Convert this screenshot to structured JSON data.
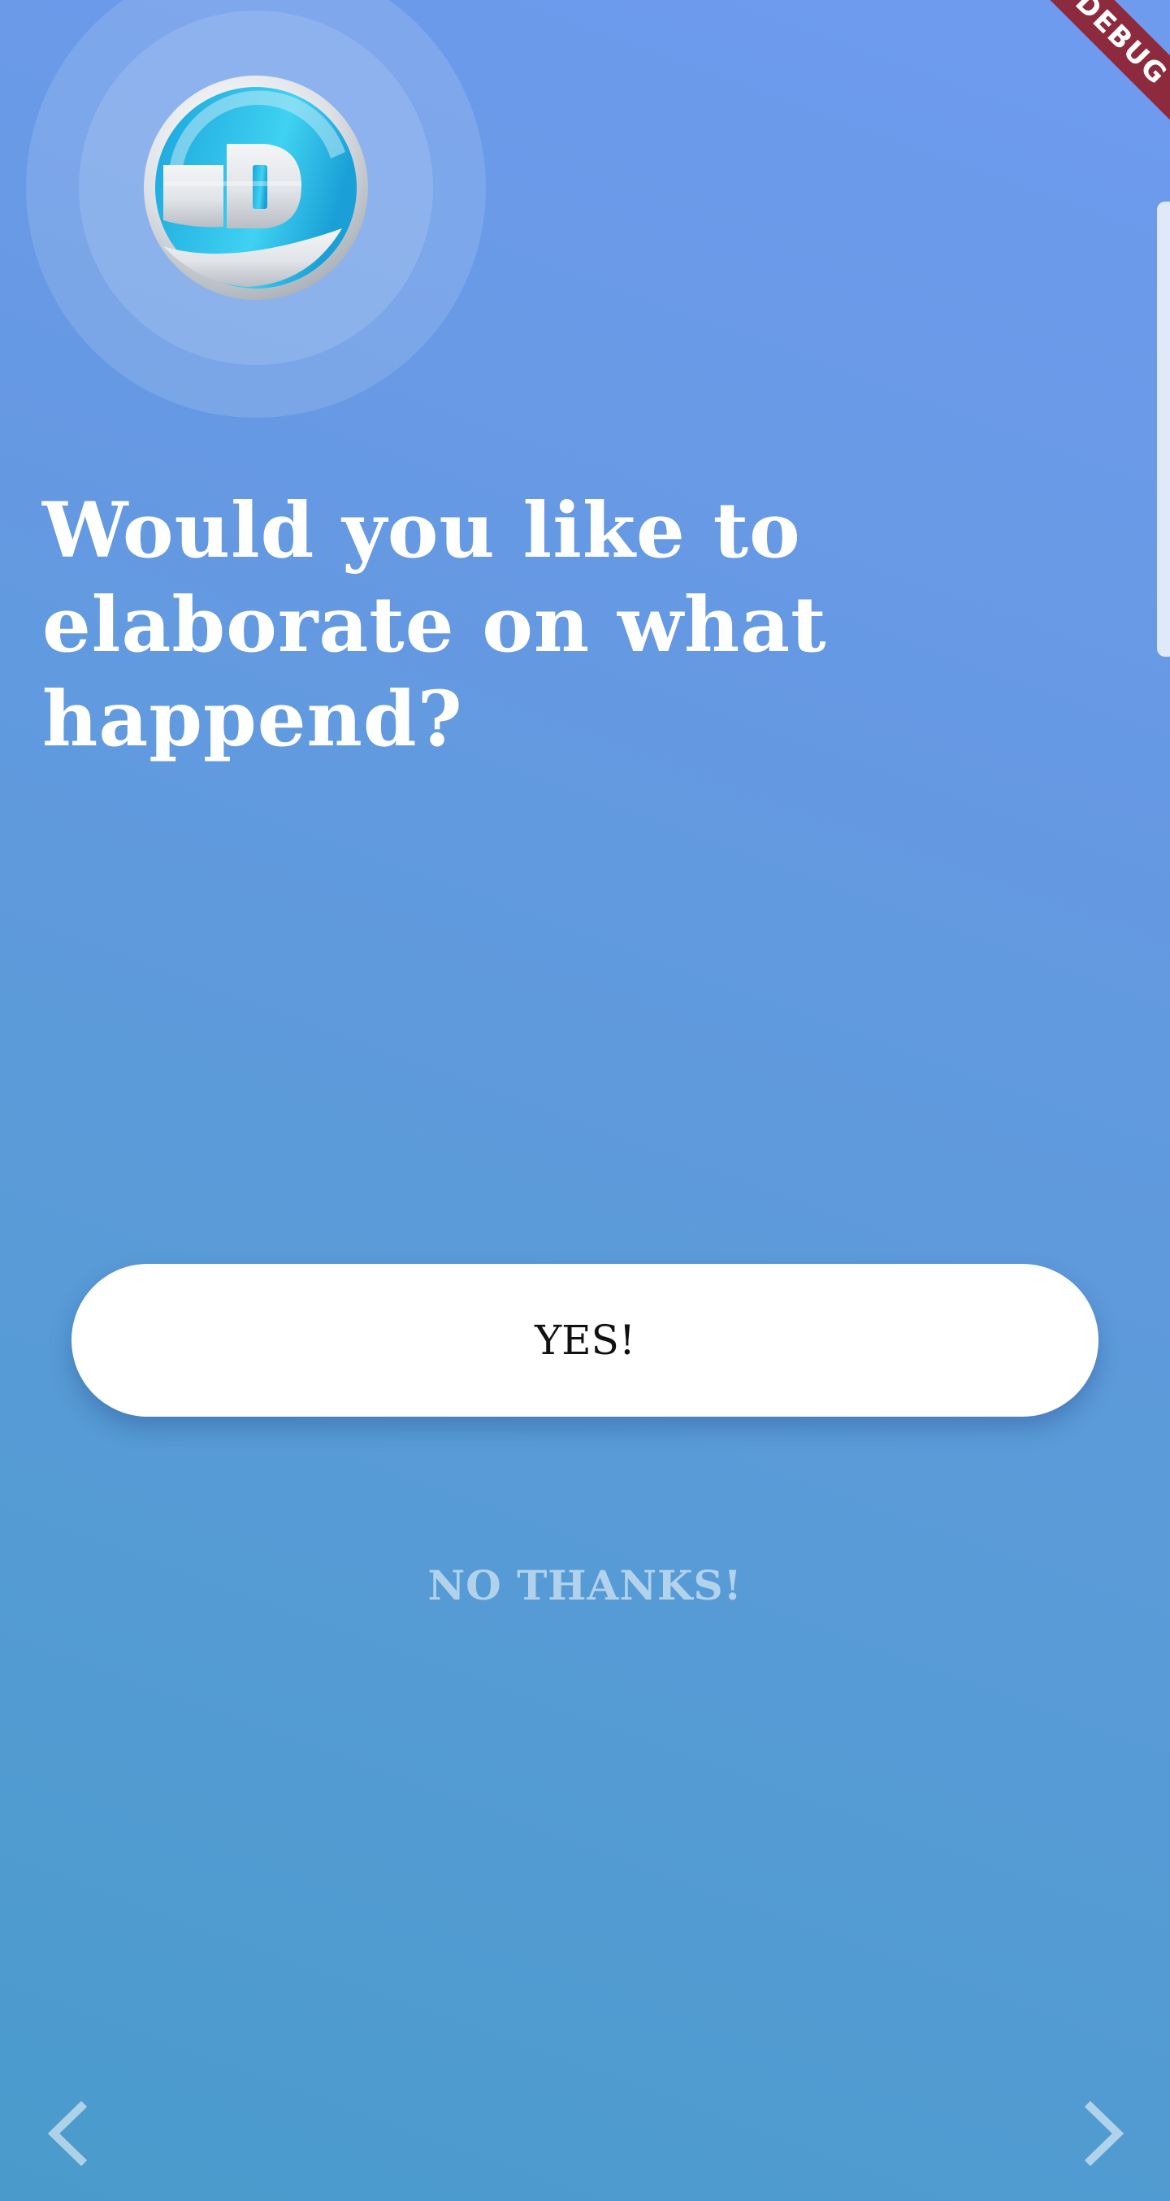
{
  "debug_banner": {
    "label": "DEBUG"
  },
  "logo": {
    "icon": "d-letter-logo",
    "colors": {
      "primary": "#29b6e8",
      "accent": "#55e2f6",
      "rim": "#d9dde2"
    }
  },
  "question": {
    "text": "Would you like to elaborate on what happend?"
  },
  "actions": {
    "yes_label": "YES!",
    "no_label": "NO THANKS!"
  },
  "navigation": {
    "prev_icon": "chevron-left-icon",
    "next_icon": "chevron-right-icon"
  },
  "colors": {
    "background_top": "#6f9bef",
    "background_bottom": "#4a9bcc",
    "button": "#ffffff",
    "debug_ribbon": "#8e2a3e"
  }
}
